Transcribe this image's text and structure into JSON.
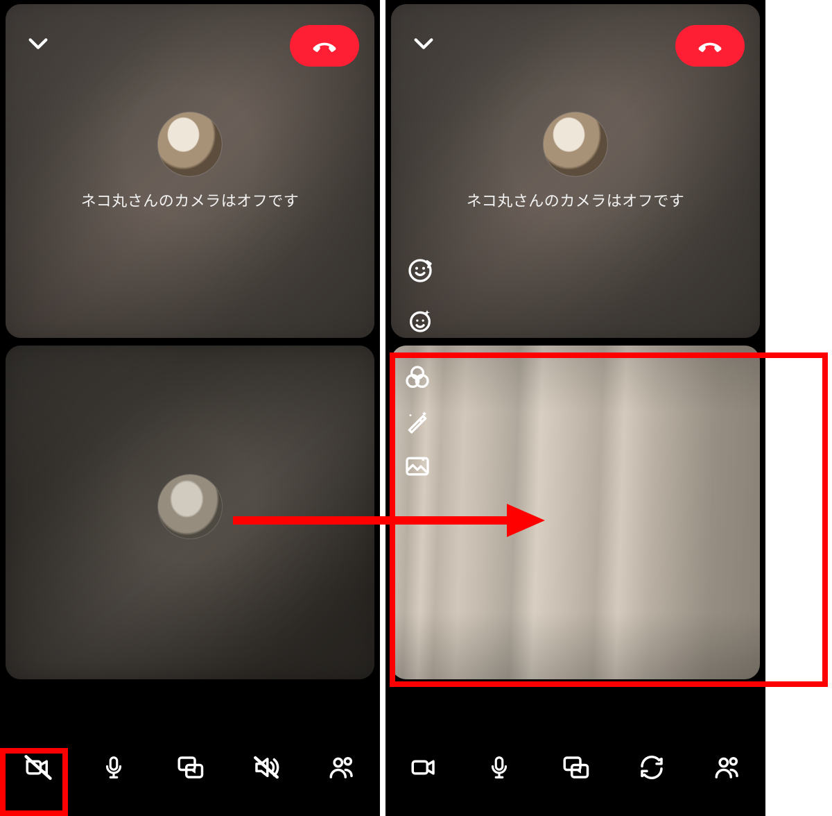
{
  "left": {
    "remote": {
      "status_text": "ネコ丸さんのカメラはオフです",
      "avatar_alt": "cat-avatar-1"
    },
    "self": {
      "avatar_alt": "cat-avatar-2"
    },
    "topbar": {
      "minimize_icon": "chevron-down-icon",
      "endcall_icon": "hangup-icon"
    },
    "toolbar": {
      "camera_off_icon": "camera-off-icon",
      "mic_icon": "mic-icon",
      "share_icon": "share-media-icon",
      "speaker_mute_icon": "speaker-mute-icon",
      "participants_icon": "participants-icon"
    }
  },
  "right": {
    "remote": {
      "status_text": "ネコ丸さんのカメラはオフです",
      "avatar_alt": "cat-avatar-1"
    },
    "self": {
      "video_alt": "self-camera-live"
    },
    "topbar": {
      "minimize_icon": "chevron-down-icon",
      "endcall_icon": "hangup-icon"
    },
    "effects_top": {
      "sticker_icon": "face-sticker-icon",
      "emoji_icon": "emoji-sparkle-icon"
    },
    "effects_bottom": {
      "filter_icon": "color-filter-icon",
      "beauty_icon": "magic-wand-icon",
      "background_icon": "background-image-icon"
    },
    "toolbar": {
      "camera_on_icon": "camera-on-icon",
      "mic_icon": "mic-icon",
      "share_icon": "share-media-icon",
      "swap_camera_icon": "swap-camera-icon",
      "participants_icon": "participants-icon"
    }
  },
  "annotations": {
    "highlight_camera_off": "camera-off-button-highlight",
    "highlight_self_video": "self-video-panel-highlight",
    "arrow": "transition-arrow"
  },
  "colors": {
    "end_call_bg": "#ff1f34",
    "highlight_stroke": "#ff0000",
    "icon_stroke": "#ffffff"
  }
}
